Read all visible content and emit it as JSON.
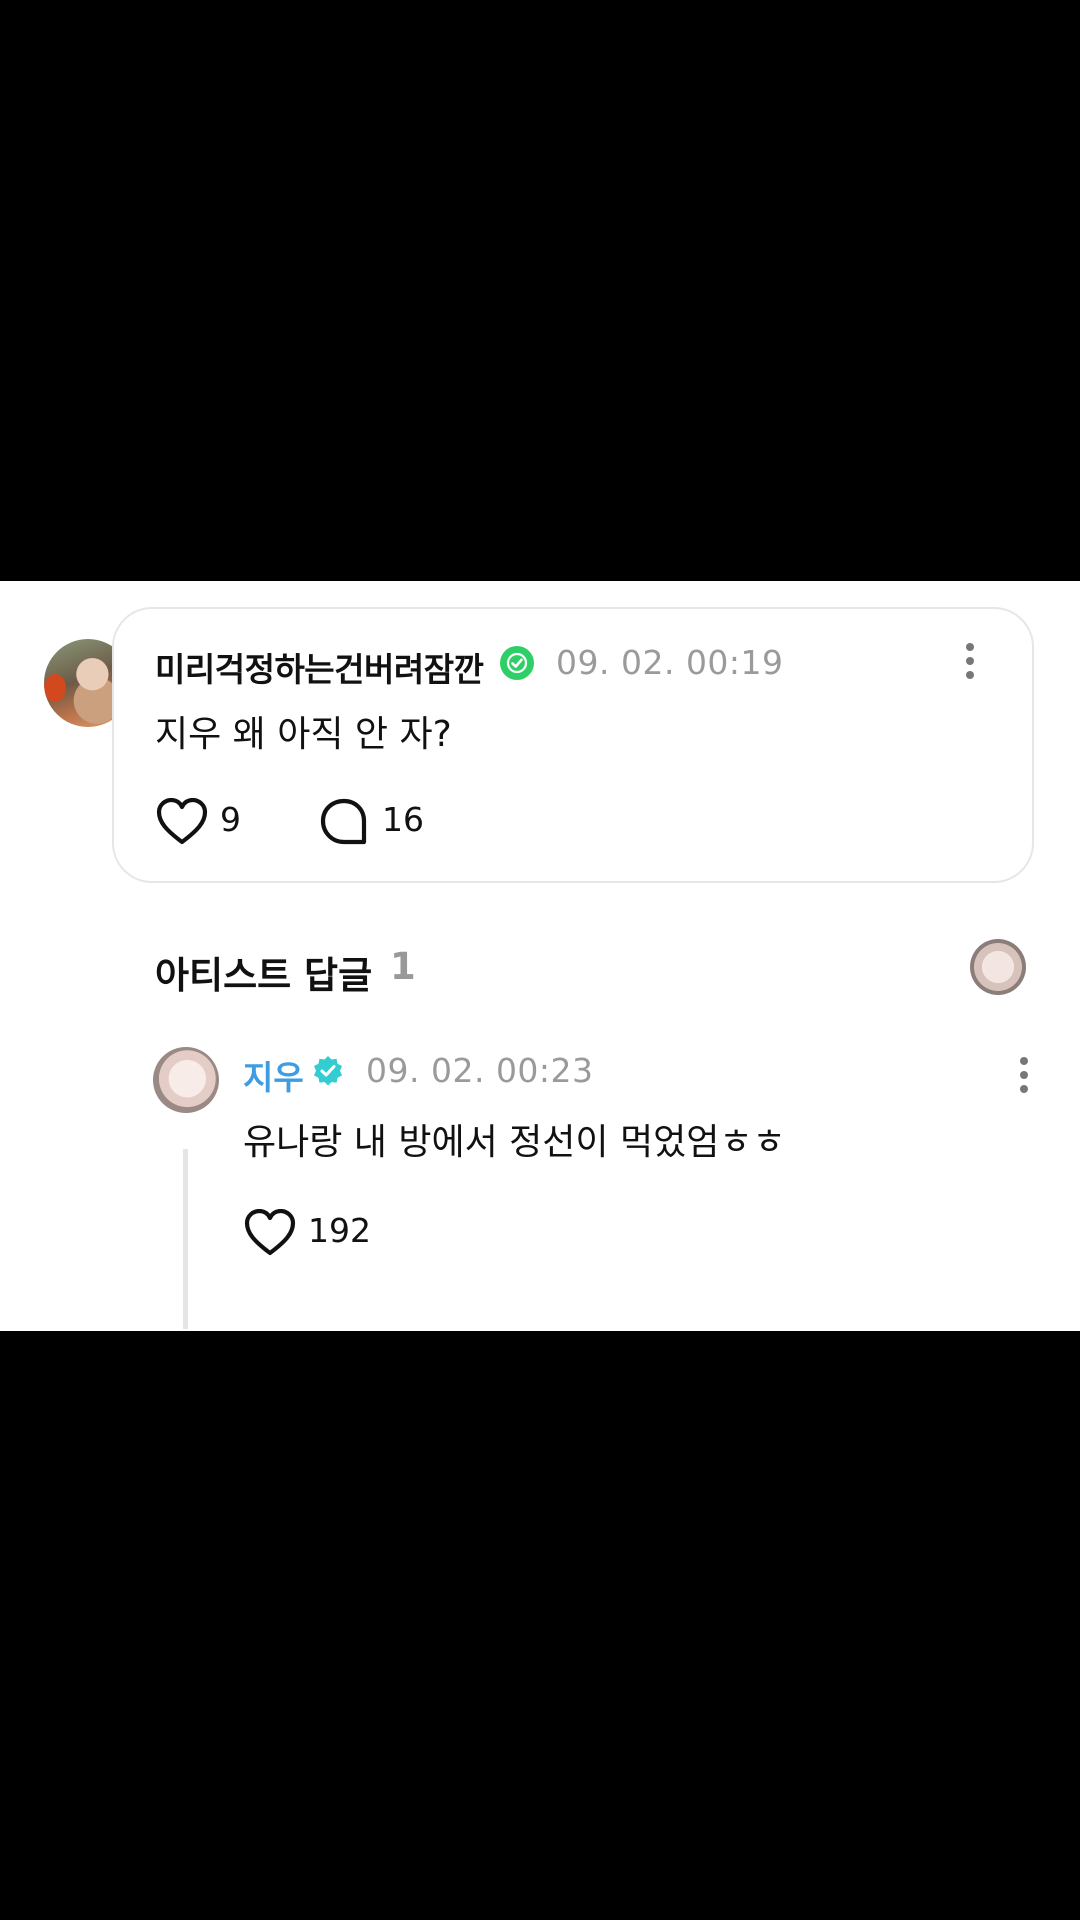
{
  "post": {
    "author": "미리걱정하는건버려잠깐",
    "timestamp": "09. 02. 00:19",
    "text": "지우 왜 아직 안 자?",
    "likes": "9",
    "comments": "16"
  },
  "artist_section": {
    "title": "아티스트 답글",
    "count": "1"
  },
  "reply": {
    "author": "지우",
    "timestamp": "09. 02. 00:23",
    "text": "유나랑 내 방에서 정선이 먹었엄ㅎㅎ",
    "likes": "192"
  },
  "icons": {
    "verified_post": "verified-check-icon",
    "verified_artist": "artist-verified-icon",
    "like": "heart-icon",
    "comment": "speech-bubble-icon",
    "more": "more-vertical-icon"
  },
  "colors": {
    "verified_green": "#2fcf67",
    "artist_name": "#3d9ce2",
    "artist_badge": "#33cdd1",
    "timestamp": "#9a9a9a"
  }
}
